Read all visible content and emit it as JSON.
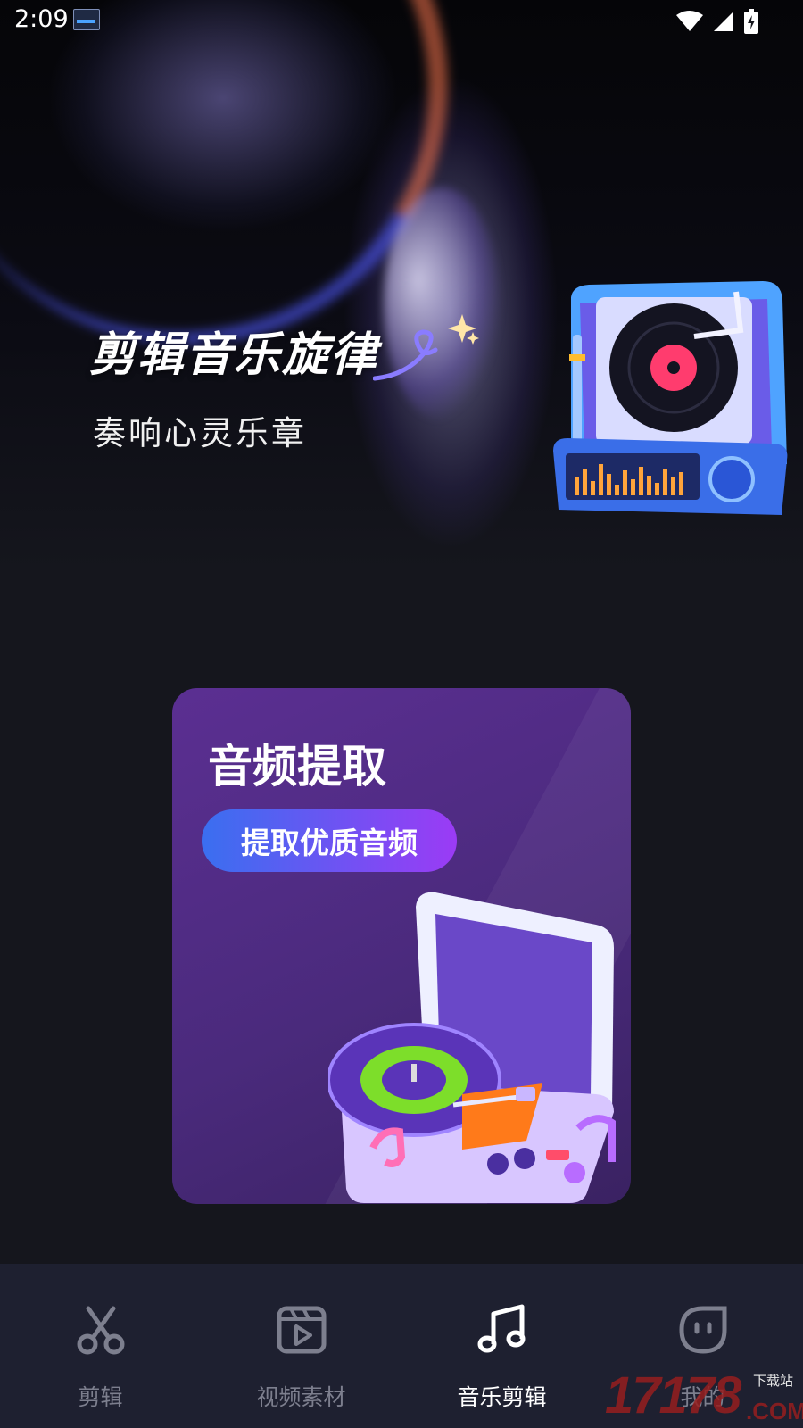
{
  "status_bar": {
    "time": "2:09",
    "icons": [
      "wifi-icon",
      "signal-icon",
      "battery-charging-icon"
    ]
  },
  "hero": {
    "title": "剪辑音乐旋律",
    "subtitle": "奏响心灵乐章"
  },
  "feature_card": {
    "title": "音频提取",
    "button_label": "提取优质音频"
  },
  "bottom_nav": {
    "items": [
      {
        "label": "剪辑",
        "icon": "scissors-icon",
        "active": false
      },
      {
        "label": "视频素材",
        "icon": "video-icon",
        "active": false
      },
      {
        "label": "音乐剪辑",
        "icon": "music-note-icon",
        "active": true
      },
      {
        "label": "我的",
        "icon": "profile-face-icon",
        "active": false
      }
    ]
  },
  "watermark": {
    "number": "17178",
    "domain": ".COM",
    "site": "下载站"
  },
  "colors": {
    "background": "#15161d",
    "nav_background": "#1e2030",
    "card_top": "#5b2f92",
    "button_start": "#3a6ff0",
    "button_end": "#9b3bf5",
    "nav_inactive": "#7d7f8e",
    "nav_active": "#ffffff"
  }
}
